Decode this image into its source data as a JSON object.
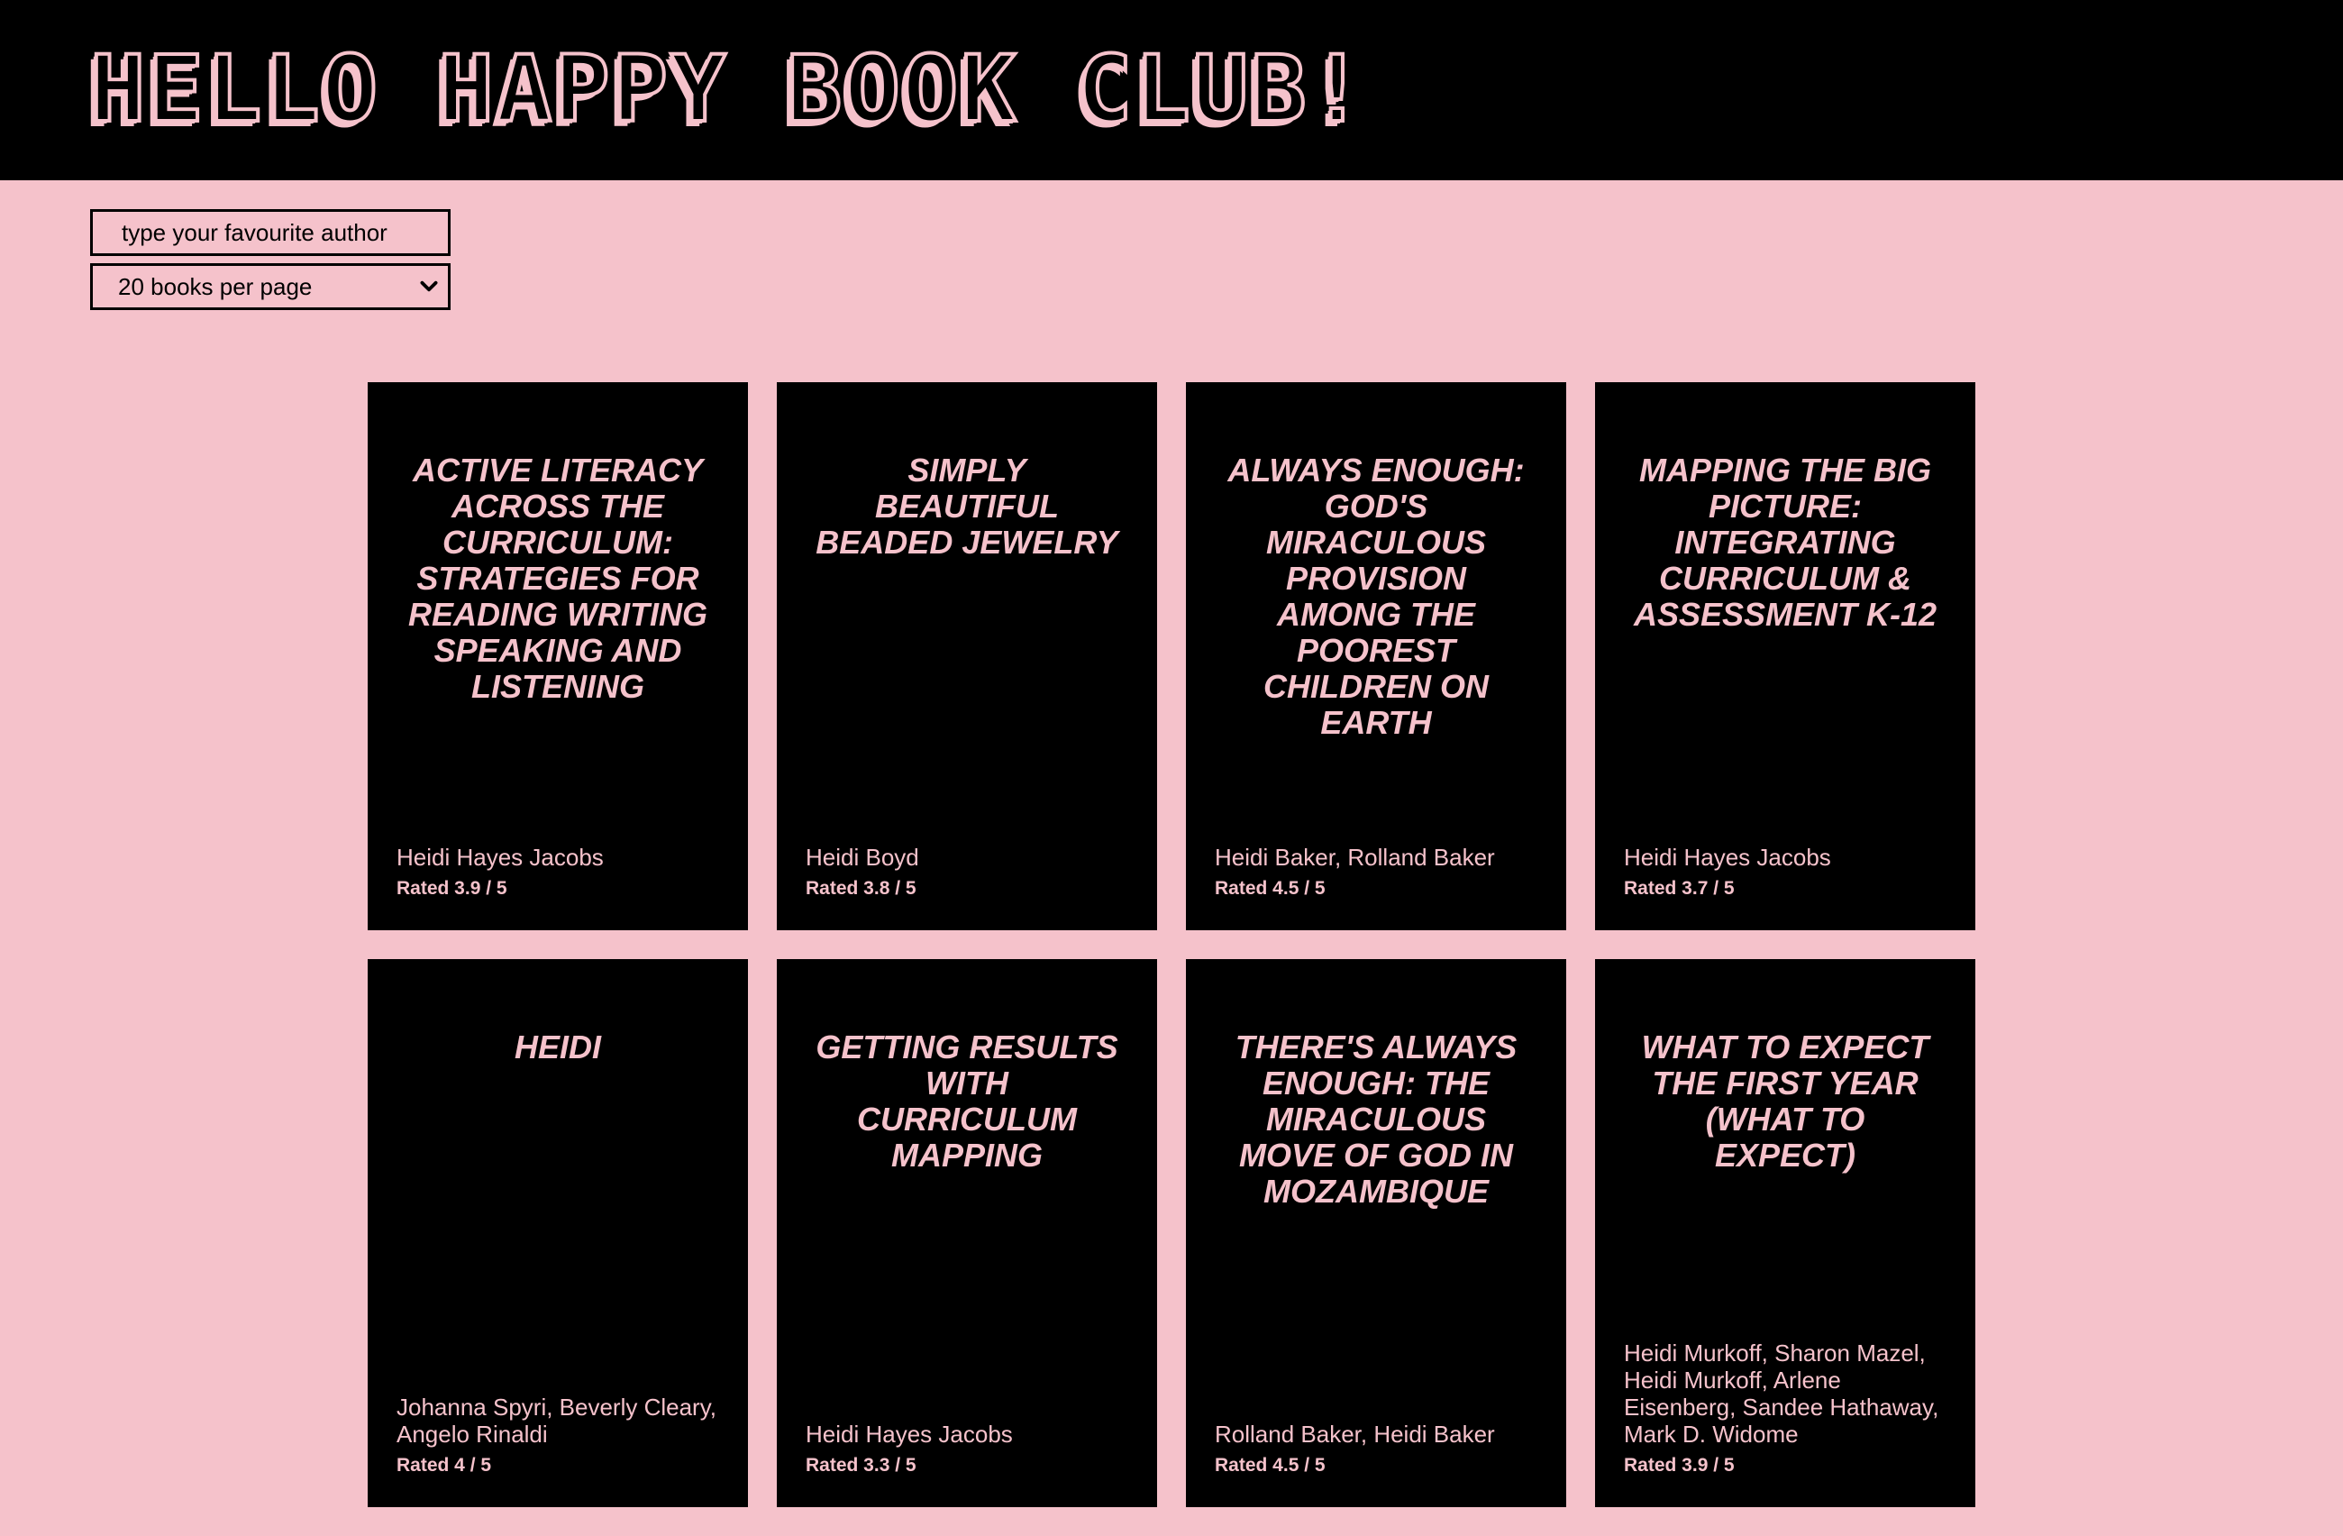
{
  "header": {
    "title": "HELLO HAPPY BOOK CLUB!"
  },
  "controls": {
    "search_placeholder": "type your favourite author",
    "per_page_selected": "20 books per page"
  },
  "books": [
    {
      "title": "ACTIVE LITERACY ACROSS THE CURRICULUM: STRATEGIES FOR READING WRITING SPEAKING AND LISTENING",
      "author": "Heidi Hayes Jacobs",
      "rating_text": "Rated 3.9 / 5"
    },
    {
      "title": "SIMPLY BEAUTIFUL BEADED JEWELRY",
      "author": "Heidi Boyd",
      "rating_text": "Rated 3.8 / 5"
    },
    {
      "title": "ALWAYS ENOUGH: GOD'S MIRACULOUS PROVISION AMONG THE POOREST CHILDREN ON EARTH",
      "author": "Heidi Baker, Rolland Baker",
      "rating_text": "Rated 4.5 / 5"
    },
    {
      "title": "MAPPING THE BIG PICTURE: INTEGRATING CURRICULUM & ASSESSMENT K-12",
      "author": "Heidi Hayes Jacobs",
      "rating_text": "Rated 3.7 / 5"
    },
    {
      "title": "HEIDI",
      "author": "Johanna Spyri, Beverly Cleary, Angelo Rinaldi",
      "rating_text": "Rated 4 / 5"
    },
    {
      "title": "GETTING RESULTS WITH CURRICULUM MAPPING",
      "author": "Heidi Hayes Jacobs",
      "rating_text": "Rated 3.3 / 5"
    },
    {
      "title": "THERE'S ALWAYS ENOUGH: THE MIRACULOUS MOVE OF GOD IN MOZAMBIQUE",
      "author": "Rolland Baker, Heidi Baker",
      "rating_text": "Rated 4.5 / 5"
    },
    {
      "title": "WHAT TO EXPECT THE FIRST YEAR (WHAT TO EXPECT)",
      "author": "Heidi Murkoff, Sharon Mazel, Heidi Murkoff, Arlene Eisenberg, Sandee Hathaway, Mark D. Widome",
      "rating_text": "Rated 3.9 / 5"
    }
  ],
  "colors": {
    "background": "#f5c2cb",
    "header_background": "#000000",
    "card_background": "#000000",
    "accent_text": "#f5c2cb"
  },
  "icons": {
    "select_chevron": "chevron-down-icon"
  }
}
